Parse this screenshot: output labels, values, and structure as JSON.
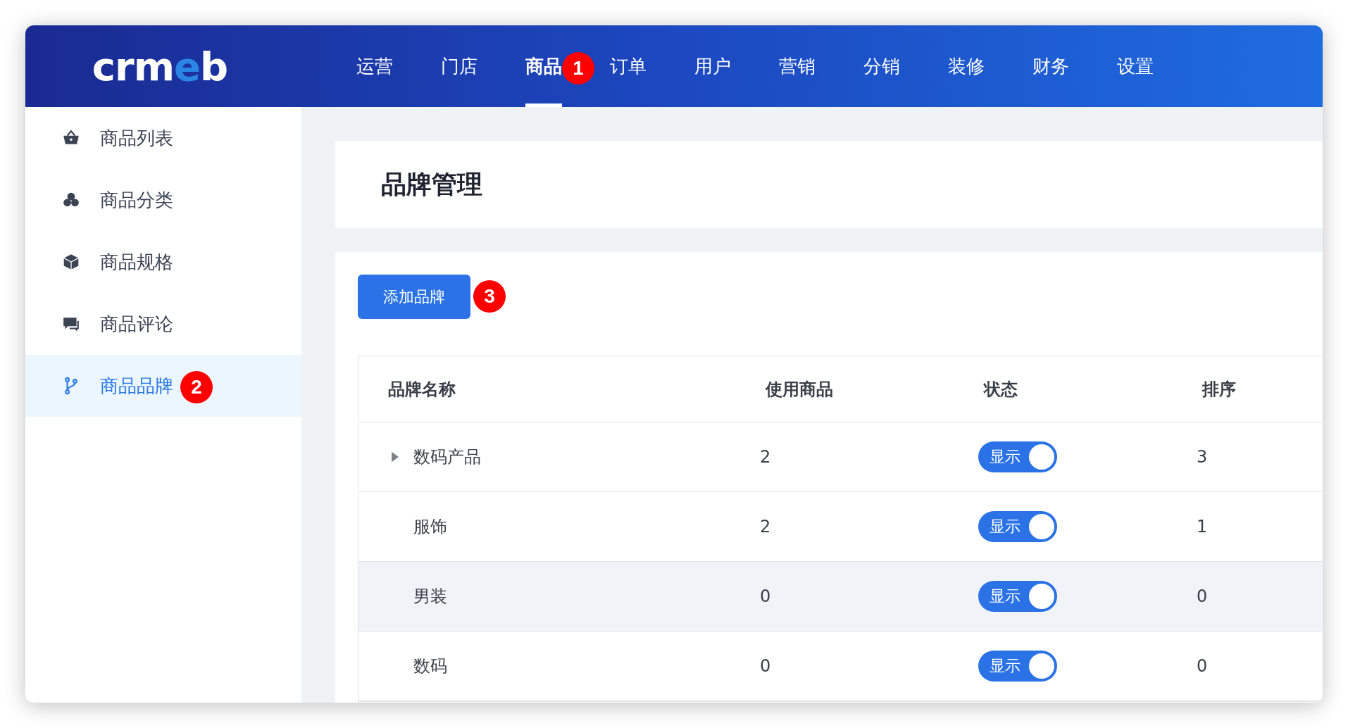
{
  "logo": "crmeb",
  "nav": [
    {
      "label": "运营",
      "selected": false
    },
    {
      "label": "门店",
      "selected": false
    },
    {
      "label": "商品",
      "selected": true,
      "badge": "1"
    },
    {
      "label": "订单",
      "selected": false
    },
    {
      "label": "用户",
      "selected": false
    },
    {
      "label": "营销",
      "selected": false
    },
    {
      "label": "分销",
      "selected": false
    },
    {
      "label": "装修",
      "selected": false
    },
    {
      "label": "财务",
      "selected": false
    },
    {
      "label": "设置",
      "selected": false
    }
  ],
  "sidebar": {
    "items": [
      {
        "label": "商品列表",
        "selected": false
      },
      {
        "label": "商品分类",
        "selected": false
      },
      {
        "label": "商品规格",
        "selected": false
      },
      {
        "label": "商品评论",
        "selected": false
      },
      {
        "label": "商品品牌",
        "selected": true,
        "badge": "2"
      }
    ]
  },
  "page_title": "品牌管理",
  "add_button": {
    "label": "添加品牌",
    "badge": "3"
  },
  "table": {
    "columns": [
      "品牌名称",
      "使用商品",
      "状态",
      "排序"
    ],
    "rows": [
      {
        "name": "数码产品",
        "expanded": false,
        "products": "2",
        "status": {
          "label": "显示",
          "on": true
        },
        "sort": "3",
        "highlighted": false
      },
      {
        "name": "服饰",
        "products": "2",
        "status": {
          "label": "显示",
          "on": true
        },
        "sort": "1",
        "highlighted": false
      },
      {
        "name": "男装",
        "products": "0",
        "status": {
          "label": "显示",
          "on": true
        },
        "sort": "0",
        "highlighted": true
      },
      {
        "name": "数码",
        "products": "0",
        "status": {
          "label": "显示",
          "on": true
        },
        "sort": "0",
        "highlighted": false
      }
    ]
  }
}
